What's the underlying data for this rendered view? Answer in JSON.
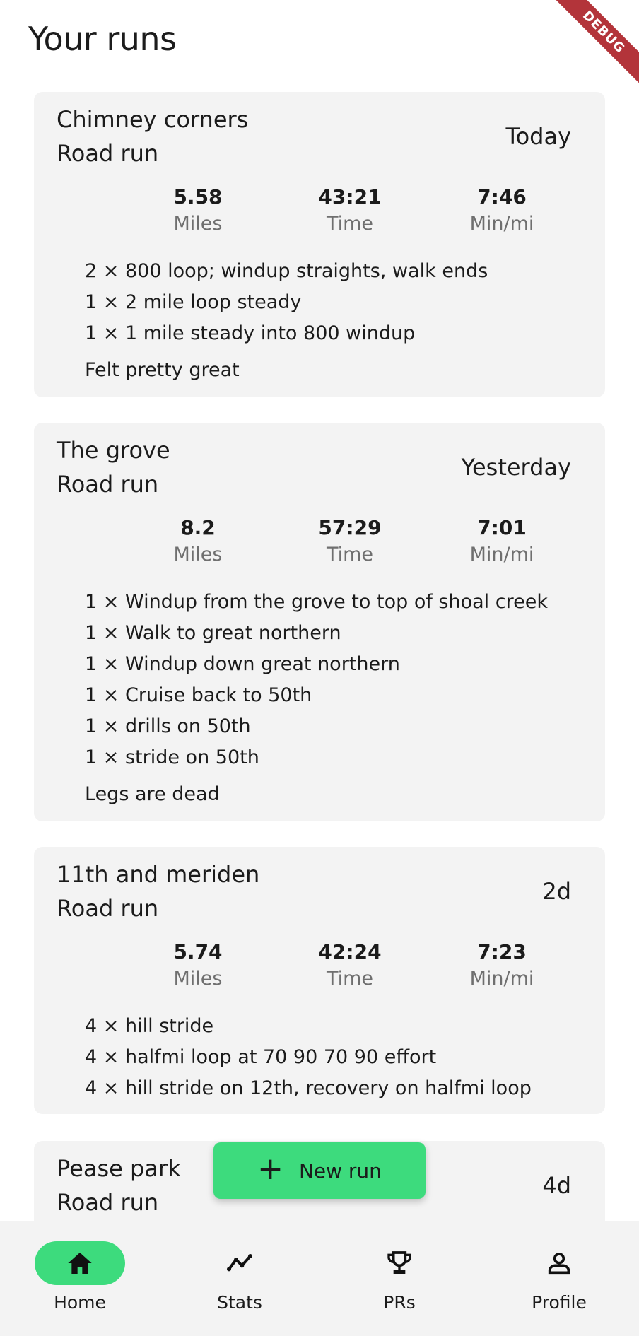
{
  "header": {
    "title": "Your runs",
    "debug_badge": "DEBUG"
  },
  "runs": [
    {
      "title": "Chimney corners",
      "type": "Road run",
      "date": "Today",
      "stats": [
        {
          "value": "5.58",
          "label": "Miles"
        },
        {
          "value": "43:21",
          "label": "Time"
        },
        {
          "value": "7:46",
          "label": "Min/mi"
        }
      ],
      "segments": [
        "2 × 800 loop; windup straights, walk ends",
        "1 × 2 mile loop steady",
        "1 × 1 mile steady into 800 windup"
      ],
      "notes": "Felt pretty great"
    },
    {
      "title": "The grove",
      "type": "Road run",
      "date": "Yesterday",
      "stats": [
        {
          "value": "8.2",
          "label": "Miles"
        },
        {
          "value": "57:29",
          "label": "Time"
        },
        {
          "value": "7:01",
          "label": "Min/mi"
        }
      ],
      "segments": [
        "1 × Windup from the grove to top of shoal creek",
        "1 × Walk to great northern",
        "1 × Windup down great northern",
        "1 × Cruise back to 50th",
        "1 × drills on 50th",
        "1 × stride on 50th"
      ],
      "notes": "Legs are dead"
    },
    {
      "title": "11th and meriden",
      "type": "Road run",
      "date": "2d",
      "stats": [
        {
          "value": "5.74",
          "label": "Miles"
        },
        {
          "value": "42:24",
          "label": "Time"
        },
        {
          "value": "7:23",
          "label": "Min/mi"
        }
      ],
      "segments": [
        "4 × hill stride",
        "4 × halfmi loop at 70 90 70 90 effort",
        "4 × hill stride on 12th, recovery on halfmi loop"
      ],
      "notes": ""
    },
    {
      "title": "Pease park",
      "type": "Road run",
      "date": "4d",
      "stats": [],
      "segments": [],
      "notes": ""
    }
  ],
  "fab": {
    "icon": "plus-icon",
    "label": "New run"
  },
  "nav": [
    {
      "label": "Home",
      "icon": "home-icon",
      "active": true
    },
    {
      "label": "Stats",
      "icon": "stats-icon",
      "active": false
    },
    {
      "label": "PRs",
      "icon": "trophy-icon",
      "active": false
    },
    {
      "label": "Profile",
      "icon": "profile-icon",
      "active": false
    }
  ],
  "colors": {
    "accent": "#3ddb7d",
    "card": "#f3f3f3",
    "debug": "#b3343a"
  }
}
